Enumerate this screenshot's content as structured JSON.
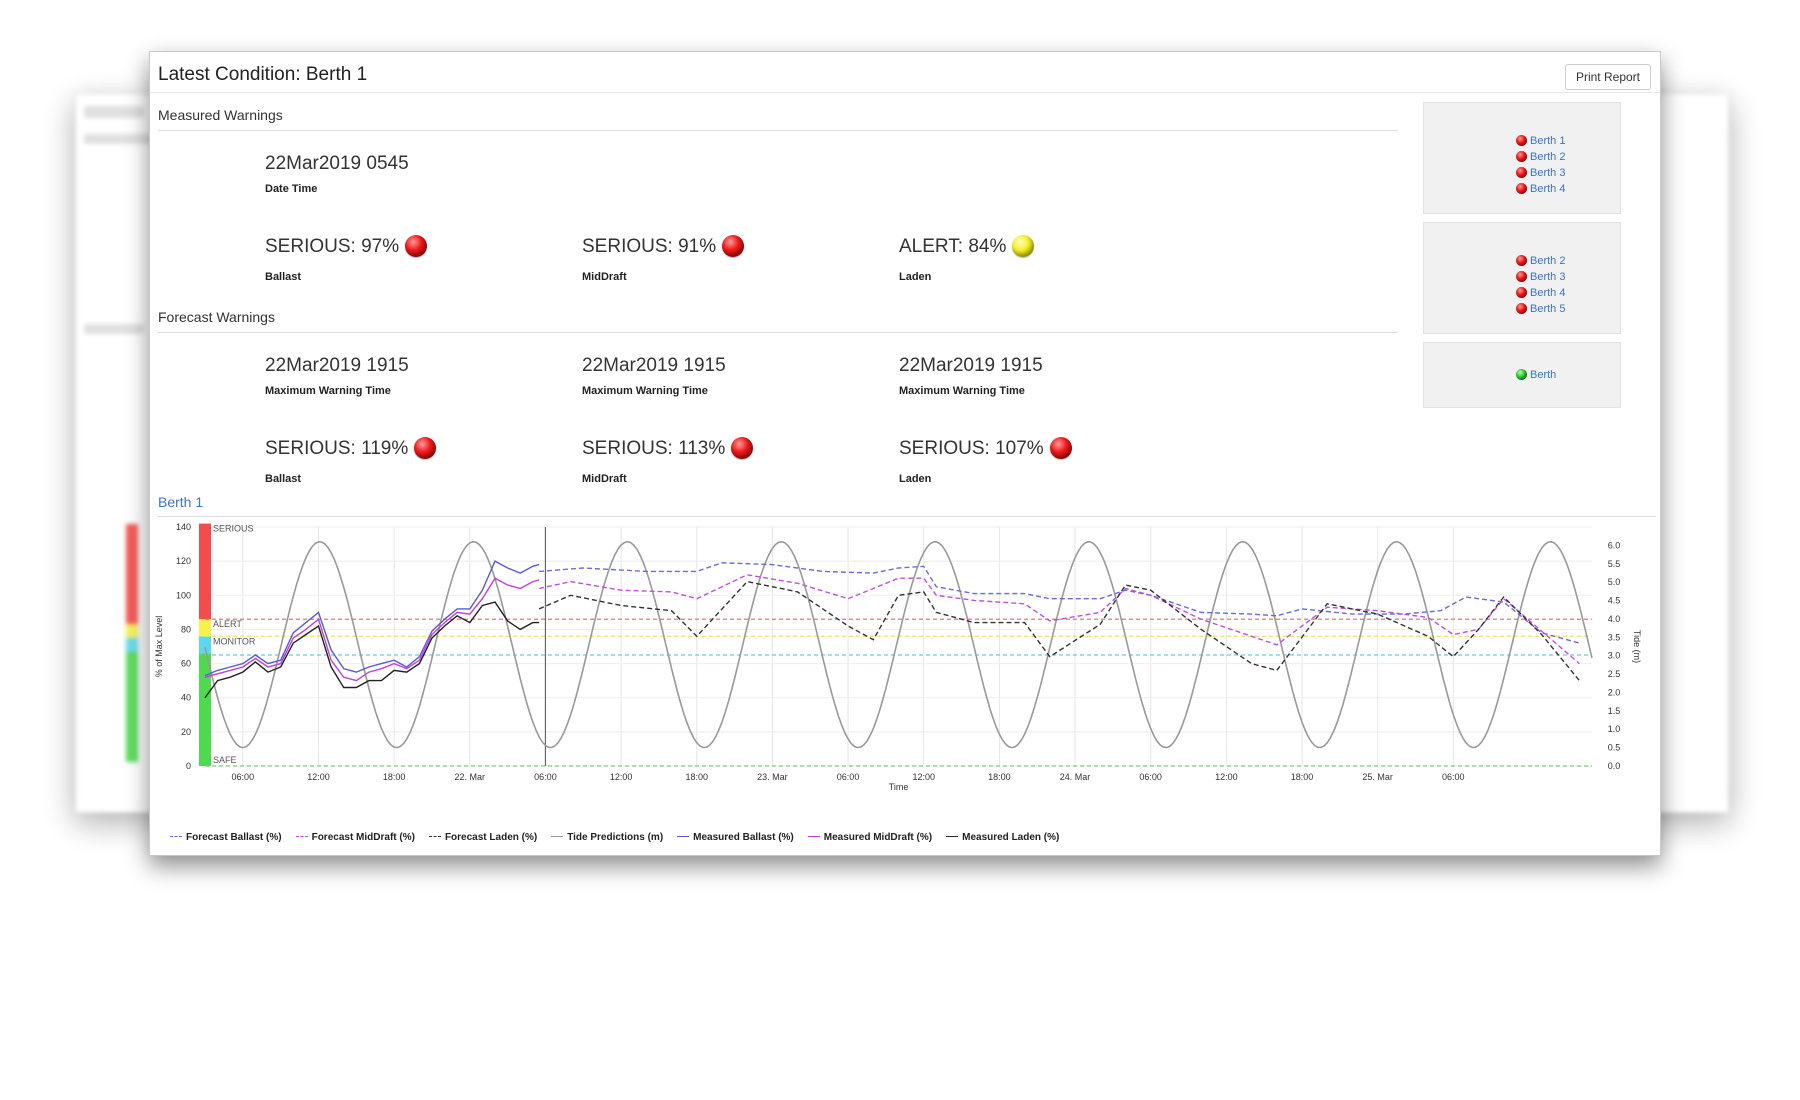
{
  "header": {
    "title": "Latest Condition: Berth 1",
    "print_label": "Print Report"
  },
  "measured": {
    "section_title": "Measured Warnings",
    "datetime": "22Mar2019 0545",
    "datetime_label": "Date Time",
    "items": [
      {
        "text": "SERIOUS: 97%",
        "label": "Ballast",
        "status": "red"
      },
      {
        "text": "SERIOUS: 91%",
        "label": "MidDraft",
        "status": "red"
      },
      {
        "text": "ALERT: 84%",
        "label": "Laden",
        "status": "yellow"
      }
    ]
  },
  "forecast": {
    "section_title": "Forecast Warnings",
    "times": [
      {
        "text": "22Mar2019 1915",
        "label": "Maximum Warning Time"
      },
      {
        "text": "22Mar2019 1915",
        "label": "Maximum Warning Time"
      },
      {
        "text": "22Mar2019 1915",
        "label": "Maximum Warning Time"
      }
    ],
    "items": [
      {
        "text": "SERIOUS: 119%",
        "label": "Ballast",
        "status": "red"
      },
      {
        "text": "SERIOUS: 113%",
        "label": "MidDraft",
        "status": "red"
      },
      {
        "text": "SERIOUS: 107%",
        "label": "Laden",
        "status": "red"
      }
    ]
  },
  "side_panels": [
    {
      "items": [
        {
          "label": "Berth 1",
          "status": "red"
        },
        {
          "label": "Berth 2",
          "status": "red"
        },
        {
          "label": "Berth 3",
          "status": "red"
        },
        {
          "label": "Berth 4",
          "status": "red"
        }
      ]
    },
    {
      "items": [
        {
          "label": "Berth 2",
          "status": "red"
        },
        {
          "label": "Berth 3",
          "status": "red"
        },
        {
          "label": "Berth 4",
          "status": "red"
        },
        {
          "label": "Berth 5",
          "status": "red"
        }
      ]
    },
    {
      "items": [
        {
          "label": "Berth",
          "status": "green"
        }
      ]
    }
  ],
  "colors": {
    "red": "#e51c1c",
    "yellow": "#efe91c",
    "green": "#1fbf1f",
    "link": "#3a75c4"
  },
  "chart_data": {
    "type": "line",
    "title": "Berth 1",
    "xlabel": "Time",
    "ylabel": "% of Max Level",
    "y2label": "Tide (m)",
    "ylim": [
      0,
      140
    ],
    "y2lim": [
      0,
      6.5
    ],
    "yticks": [
      0,
      20,
      40,
      60,
      80,
      100,
      120,
      140
    ],
    "y2ticks": [
      "0.0",
      "0.5",
      "1.0",
      "1.5",
      "2.0",
      "2.5",
      "3.0",
      "3.5",
      "4.0",
      "4.5",
      "5.0",
      "5.5",
      "6.0"
    ],
    "xlim": [
      3,
      80
    ],
    "xticks": [
      {
        "x": 6,
        "label": "06:00"
      },
      {
        "x": 12,
        "label": "12:00"
      },
      {
        "x": 18,
        "label": "18:00"
      },
      {
        "x": 24,
        "label": "22. Mar"
      },
      {
        "x": 30,
        "label": "06:00"
      },
      {
        "x": 36,
        "label": "12:00"
      },
      {
        "x": 42,
        "label": "18:00"
      },
      {
        "x": 48,
        "label": "23. Mar"
      },
      {
        "x": 54,
        "label": "06:00"
      },
      {
        "x": 60,
        "label": "12:00"
      },
      {
        "x": 66,
        "label": "18:00"
      },
      {
        "x": 72,
        "label": "24. Mar"
      },
      {
        "x": 78,
        "label": "06:00"
      },
      {
        "x": 84,
        "label": "12:00"
      },
      {
        "x": 90,
        "label": "18:00"
      },
      {
        "x": 96,
        "label": "25. Mar"
      },
      {
        "x": 102,
        "label": "06:00"
      }
    ],
    "bands": [
      {
        "name": "SAFE",
        "from": 0,
        "to": 66,
        "color": "#4fd94f"
      },
      {
        "name": "MONITOR",
        "from": 66,
        "to": 76,
        "color": "#5cd8ee"
      },
      {
        "name": "ALERT",
        "from": 76,
        "to": 86,
        "color": "#f7f24a"
      },
      {
        "name": "SERIOUS",
        "from": 86,
        "to": 142,
        "color": "#f24c4c"
      }
    ],
    "threshold_lines": [
      {
        "value": 86,
        "color": "#e06666"
      },
      {
        "value": 76,
        "color": "#e9e46a"
      },
      {
        "value": 65,
        "color": "#66ccdd"
      },
      {
        "value": 0,
        "color": "#77cc77"
      }
    ],
    "now_x": 30,
    "series": [
      {
        "name": "Forecast Ballast (%)",
        "color": "#6a6ad8",
        "dash": true,
        "points": [
          [
            29.5,
            114
          ],
          [
            33,
            116
          ],
          [
            38,
            114
          ],
          [
            42,
            114
          ],
          [
            44,
            119
          ],
          [
            48,
            118
          ],
          [
            52,
            114
          ],
          [
            56,
            113
          ],
          [
            58,
            116
          ],
          [
            60,
            117
          ],
          [
            61,
            105
          ],
          [
            64,
            101
          ],
          [
            68,
            101
          ],
          [
            70,
            98
          ],
          [
            74,
            98
          ],
          [
            76,
            103
          ],
          [
            78,
            100
          ],
          [
            82,
            90
          ],
          [
            86,
            89
          ],
          [
            88,
            88
          ],
          [
            90,
            92
          ],
          [
            94,
            89
          ],
          [
            98,
            89
          ],
          [
            101,
            91
          ],
          [
            103,
            99
          ],
          [
            106,
            96
          ],
          [
            109,
            78
          ],
          [
            112,
            72
          ]
        ]
      },
      {
        "name": "Forecast MidDraft (%)",
        "color": "#c14fd9",
        "dash": true,
        "points": [
          [
            29.5,
            104
          ],
          [
            32,
            108
          ],
          [
            36,
            103
          ],
          [
            40,
            102
          ],
          [
            42,
            98
          ],
          [
            46,
            112
          ],
          [
            50,
            107
          ],
          [
            54,
            98
          ],
          [
            56,
            104
          ],
          [
            58,
            110
          ],
          [
            60,
            110
          ],
          [
            61,
            100
          ],
          [
            64,
            97
          ],
          [
            68,
            95
          ],
          [
            70,
            85
          ],
          [
            74,
            90
          ],
          [
            76,
            104
          ],
          [
            78,
            100
          ],
          [
            82,
            86
          ],
          [
            86,
            76
          ],
          [
            88,
            71
          ],
          [
            92,
            93
          ],
          [
            96,
            91
          ],
          [
            100,
            87
          ],
          [
            102,
            77
          ],
          [
            104,
            80
          ],
          [
            106,
            98
          ],
          [
            109,
            79
          ],
          [
            112,
            60
          ]
        ]
      },
      {
        "name": "Forecast Laden (%)",
        "color": "#333333",
        "dash": true,
        "points": [
          [
            29.5,
            92
          ],
          [
            32,
            100
          ],
          [
            36,
            94
          ],
          [
            40,
            91
          ],
          [
            42,
            76
          ],
          [
            46,
            108
          ],
          [
            50,
            102
          ],
          [
            54,
            82
          ],
          [
            56,
            74
          ],
          [
            58,
            100
          ],
          [
            60,
            102
          ],
          [
            61,
            90
          ],
          [
            64,
            84
          ],
          [
            68,
            84
          ],
          [
            70,
            64
          ],
          [
            74,
            83
          ],
          [
            76,
            106
          ],
          [
            78,
            103
          ],
          [
            82,
            80
          ],
          [
            86,
            60
          ],
          [
            88,
            56
          ],
          [
            92,
            95
          ],
          [
            96,
            89
          ],
          [
            100,
            76
          ],
          [
            102,
            64
          ],
          [
            104,
            80
          ],
          [
            106,
            99
          ],
          [
            109,
            77
          ],
          [
            112,
            50
          ]
        ]
      },
      {
        "name": "Tide Predictions (m)",
        "color": "#999999",
        "dash": false,
        "tide": true
      },
      {
        "name": "Measured Ballast (%)",
        "color": "#5a5ad6",
        "dash": false,
        "points": [
          [
            3,
            53
          ],
          [
            4,
            56
          ],
          [
            5,
            58
          ],
          [
            6,
            60
          ],
          [
            7,
            65
          ],
          [
            8,
            60
          ],
          [
            9,
            62
          ],
          [
            10,
            78
          ],
          [
            11,
            84
          ],
          [
            12,
            90
          ],
          [
            13,
            68
          ],
          [
            14,
            57
          ],
          [
            15,
            55
          ],
          [
            16,
            58
          ],
          [
            17,
            60
          ],
          [
            18,
            62
          ],
          [
            19,
            58
          ],
          [
            20,
            64
          ],
          [
            21,
            79
          ],
          [
            22,
            86
          ],
          [
            23,
            92
          ],
          [
            24,
            92
          ],
          [
            25,
            103
          ],
          [
            26,
            120
          ],
          [
            27,
            116
          ],
          [
            28,
            113
          ],
          [
            29,
            117
          ],
          [
            29.5,
            118
          ]
        ]
      },
      {
        "name": "Measured MidDraft (%)",
        "color": "#c040d8",
        "dash": false,
        "points": [
          [
            3,
            52
          ],
          [
            4,
            54
          ],
          [
            5,
            56
          ],
          [
            6,
            58
          ],
          [
            7,
            63
          ],
          [
            8,
            58
          ],
          [
            9,
            60
          ],
          [
            10,
            75
          ],
          [
            11,
            80
          ],
          [
            12,
            86
          ],
          [
            13,
            62
          ],
          [
            14,
            52
          ],
          [
            15,
            50
          ],
          [
            16,
            55
          ],
          [
            17,
            57
          ],
          [
            18,
            60
          ],
          [
            19,
            57
          ],
          [
            20,
            62
          ],
          [
            21,
            77
          ],
          [
            22,
            84
          ],
          [
            23,
            90
          ],
          [
            24,
            89
          ],
          [
            25,
            98
          ],
          [
            26,
            110
          ],
          [
            27,
            106
          ],
          [
            28,
            104
          ],
          [
            29,
            108
          ],
          [
            29.5,
            109
          ]
        ]
      },
      {
        "name": "Measured Laden (%)",
        "color": "#222222",
        "dash": false,
        "points": [
          [
            3,
            40
          ],
          [
            4,
            50
          ],
          [
            5,
            52
          ],
          [
            6,
            55
          ],
          [
            7,
            61
          ],
          [
            8,
            55
          ],
          [
            9,
            58
          ],
          [
            10,
            72
          ],
          [
            11,
            77
          ],
          [
            12,
            82
          ],
          [
            13,
            58
          ],
          [
            14,
            46
          ],
          [
            15,
            46
          ],
          [
            16,
            50
          ],
          [
            17,
            50
          ],
          [
            18,
            56
          ],
          [
            19,
            55
          ],
          [
            20,
            60
          ],
          [
            21,
            75
          ],
          [
            22,
            82
          ],
          [
            23,
            88
          ],
          [
            24,
            84
          ],
          [
            25,
            94
          ],
          [
            26,
            96
          ],
          [
            27,
            85
          ],
          [
            28,
            80
          ],
          [
            29,
            84
          ],
          [
            29.5,
            84
          ]
        ]
      }
    ]
  }
}
